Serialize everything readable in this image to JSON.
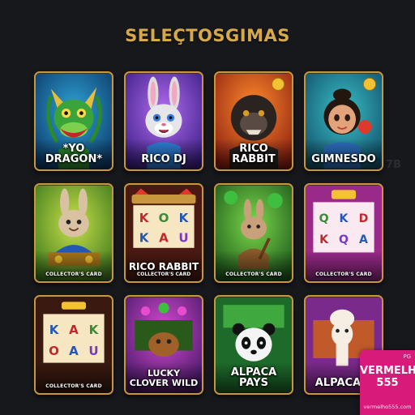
{
  "page": {
    "title": "SELEÇTOSGIMAS"
  },
  "games": [
    {
      "title": "*YO DRAGON*",
      "sub": ""
    },
    {
      "title": "RICO DJ",
      "sub": ""
    },
    {
      "title": "RICO RABBIT",
      "sub": ""
    },
    {
      "title": "GIMNESDO",
      "sub": ""
    },
    {
      "title": "",
      "sub": "COLLECTOR'S CARD"
    },
    {
      "title": "RICO RABBIT",
      "sub": "COLLECTOR'S CARD"
    },
    {
      "title": "",
      "sub": "COLLECTOR'S CARD"
    },
    {
      "title": "",
      "sub": "COLLECTOR'S CARD"
    },
    {
      "title": "",
      "sub": "COLLECTOR'S CARD"
    },
    {
      "title": "LUCKY CLOVER WILD",
      "sub": ""
    },
    {
      "title": "ALPACA PAYS",
      "sub": ""
    },
    {
      "title": "ALPACA P",
      "sub": ""
    }
  ],
  "reels": {
    "card6": [
      "K",
      "O",
      "K",
      "K",
      "A",
      "U"
    ],
    "card8": [
      "Q",
      "K",
      "D",
      "K",
      "Q",
      "A"
    ],
    "card9": [
      "K",
      "A",
      "K",
      "O",
      "A",
      "U"
    ]
  },
  "watermark": "7B",
  "badge": {
    "corner": "PG",
    "brand_line1": "VERMELHO",
    "brand_line2": "555",
    "url": "vermelho555.com"
  },
  "colors": {
    "background": "#17181c",
    "gold": "#d6a94a",
    "badge": "#d81b7a"
  }
}
